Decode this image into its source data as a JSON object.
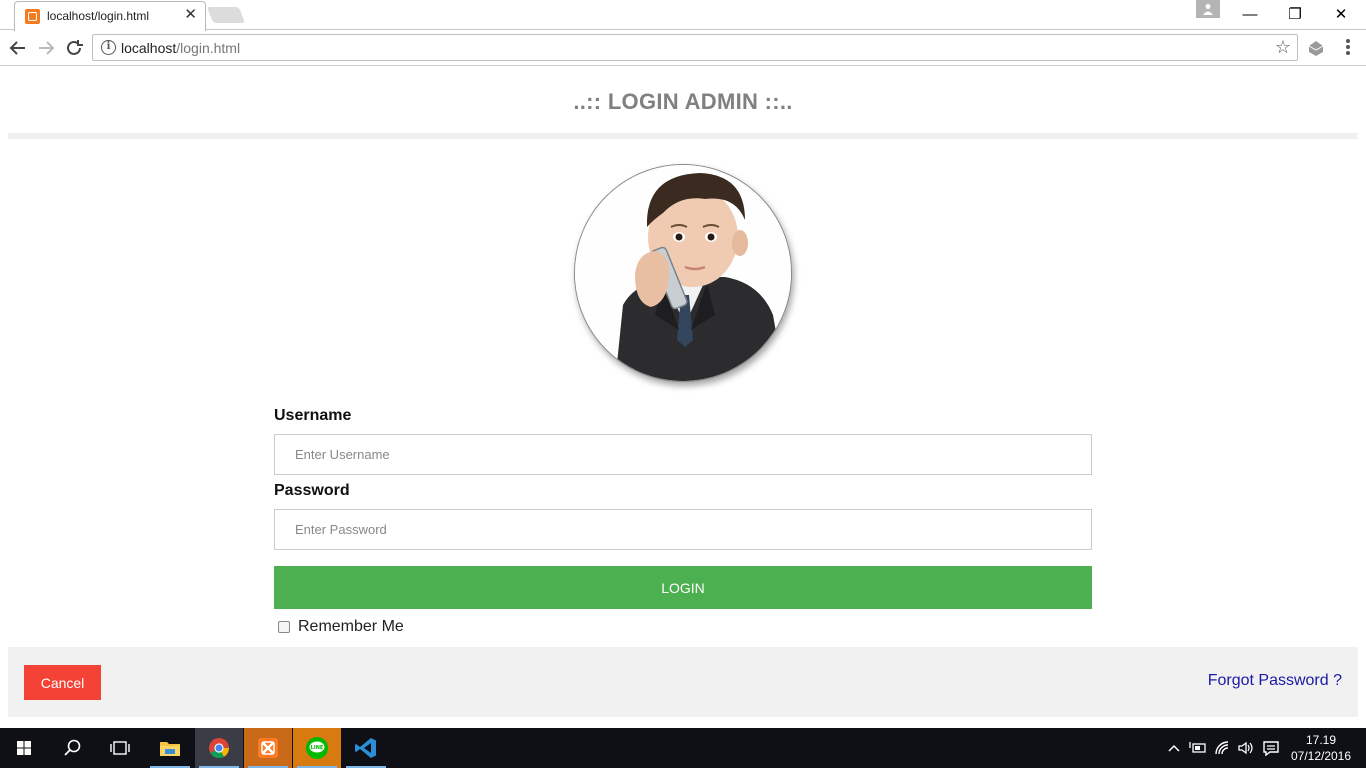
{
  "browser": {
    "tab_title": "localhost/login.html",
    "tab_close": "✕",
    "url_host": "localhost",
    "url_path": "/login.html",
    "window_controls": {
      "minimize": "—",
      "restore": "❐",
      "close": "✕"
    }
  },
  "page": {
    "heading": "..:: LOGIN ADMIN ::..",
    "username_label": "Username",
    "username_placeholder": "Enter Username",
    "password_label": "Password",
    "password_placeholder": "Enter Password",
    "login_button": "LOGIN",
    "remember_label": "Remember Me",
    "cancel_button": "Cancel",
    "forgot_link": "Forgot Password ?"
  },
  "colors": {
    "login_green": "#4caf50",
    "cancel_red": "#f44336",
    "link_blue": "#1a1aa6",
    "heading_gray": "#808080"
  },
  "taskbar": {
    "apps": [
      "start-icon",
      "search-icon",
      "task-view-icon",
      "file-explorer-icon",
      "chrome-icon",
      "xampp-icon",
      "line-icon",
      "vscode-icon"
    ],
    "clock_time": "17.19",
    "clock_date": "07/12/2016"
  }
}
